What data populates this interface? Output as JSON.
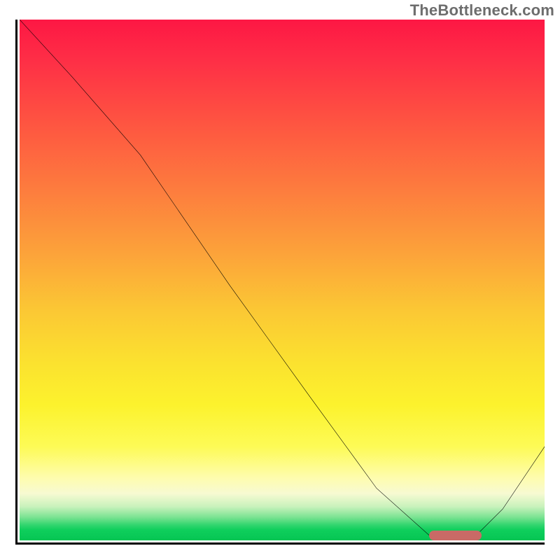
{
  "watermark": "TheBottleneck.com",
  "colors": {
    "gradient_top": "#fd1744",
    "gradient_mid": "#fbe22f",
    "gradient_bottom": "#05c553",
    "curve": "#000000",
    "marker": "#c96a66",
    "axis": "#000000"
  },
  "chart_data": {
    "type": "line",
    "title": "",
    "xlabel": "",
    "ylabel": "",
    "xlim": [
      0,
      100
    ],
    "ylim": [
      0,
      100
    ],
    "grid": false,
    "legend": false,
    "series": [
      {
        "name": "bottleneck-curve",
        "x": [
          0,
          10,
          23,
          40,
          55,
          68,
          78,
          83,
          86,
          92,
          100
        ],
        "y": [
          100,
          89,
          74,
          49,
          28,
          10,
          1,
          0,
          0,
          6,
          18
        ]
      }
    ],
    "marker": {
      "name": "optimal-range",
      "x_start": 78,
      "x_end": 88,
      "y": 0
    },
    "background_gradient_stops": [
      {
        "pos": 0,
        "color": "#fd1744"
      },
      {
        "pos": 50,
        "color": "#fca33a"
      },
      {
        "pos": 75,
        "color": "#fcf22d"
      },
      {
        "pos": 92,
        "color": "#c9f2bc"
      },
      {
        "pos": 100,
        "color": "#05c553"
      }
    ]
  }
}
